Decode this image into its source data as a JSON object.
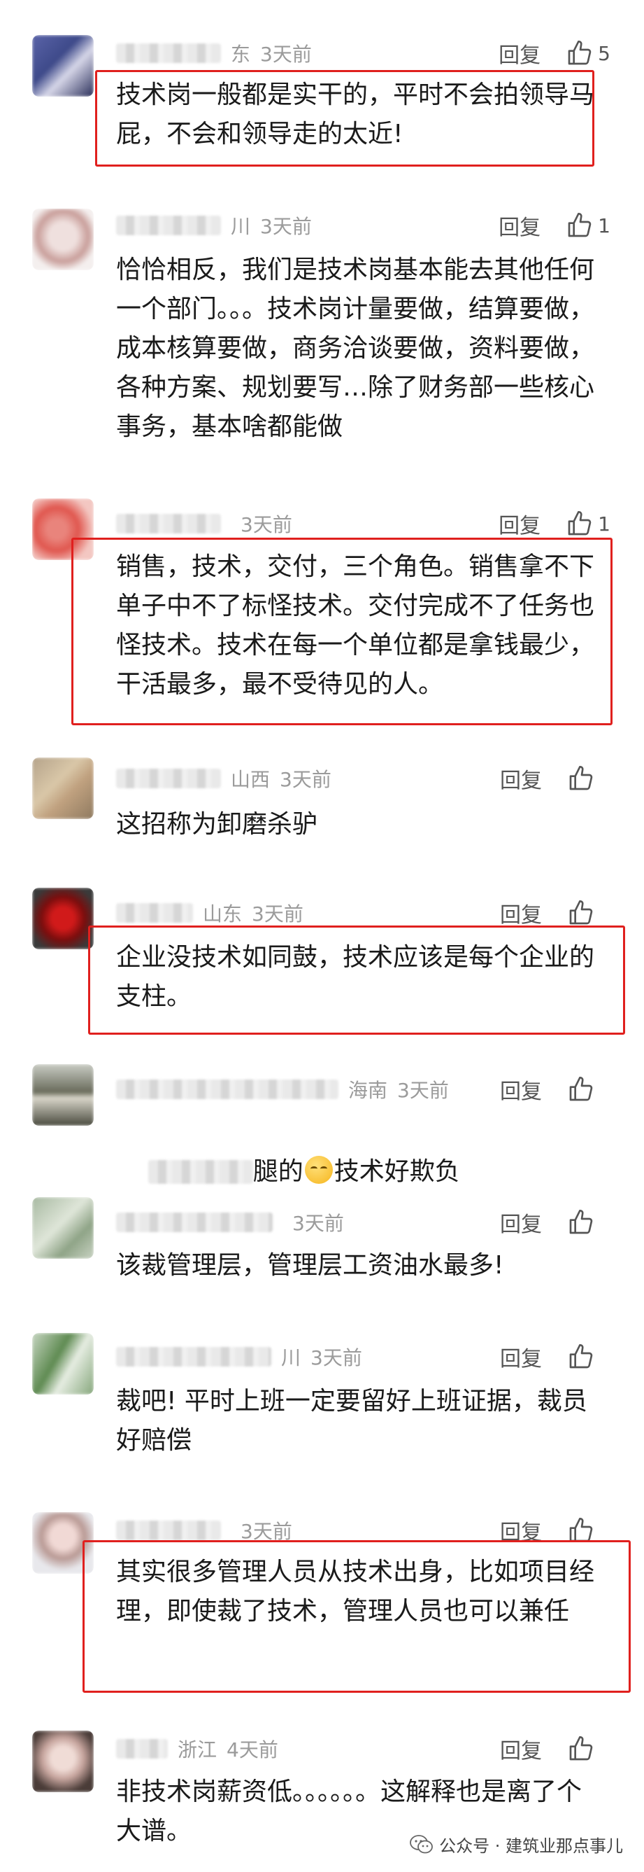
{
  "reply_label": "回复",
  "comments": [
    {
      "region": "东",
      "time": "3天前",
      "likes": "5",
      "text": "技术岗一般都是实干的，平时不会拍领导马屁，不会和领导走的太近!"
    },
    {
      "region": "川",
      "time": "3天前",
      "likes": "1",
      "text": "恰恰相反，我们是技术岗基本能去其他任何一个部门。。。技术岗计量要做，结算要做，成本核算要做，商务洽谈要做，资料要做，各种方案、规划要写…除了财务部一些核心事务，基本啥都能做"
    },
    {
      "region": "",
      "time": "3天前",
      "likes": "1",
      "text": "销售，技术，交付，三个角色。销售拿不下单子中不了标怪技术。交付完成不了任务也怪技术。技术在每一个单位都是拿钱最少，干活最多，最不受待见的人。"
    },
    {
      "region": "山西",
      "time": "3天前",
      "likes": "",
      "text": "这招称为卸磨杀驴"
    },
    {
      "region": "山东",
      "time": "3天前",
      "likes": "",
      "text": "企业没技术如同鼓，技术应该是每个企业的支柱。"
    },
    {
      "region": "海南",
      "time": "3天前",
      "likes": "",
      "text_before": "腿的",
      "text_after": "技术好欺负"
    },
    {
      "region": "",
      "time": "3天前",
      "likes": "",
      "text": "该裁管理层，管理层工资油水最多!"
    },
    {
      "region": "川",
      "time": "3天前",
      "likes": "",
      "text": "裁吧! 平时上班一定要留好上班证据，裁员好赔偿"
    },
    {
      "region": "",
      "time": "3天前",
      "likes": "",
      "text": "其实很多管理人员从技术出身，比如项目经理，即使裁了技术，管理人员也可以兼任"
    },
    {
      "region": "浙江",
      "time": "4天前",
      "likes": "",
      "text": "非技术岗薪资低。。。。。。这解释也是离了个大谱。"
    }
  ],
  "watermark": "公众号 · 建筑业那点事儿",
  "colors": {
    "highlight": "#e0201e",
    "meta_gray": "#9b9b9b"
  }
}
